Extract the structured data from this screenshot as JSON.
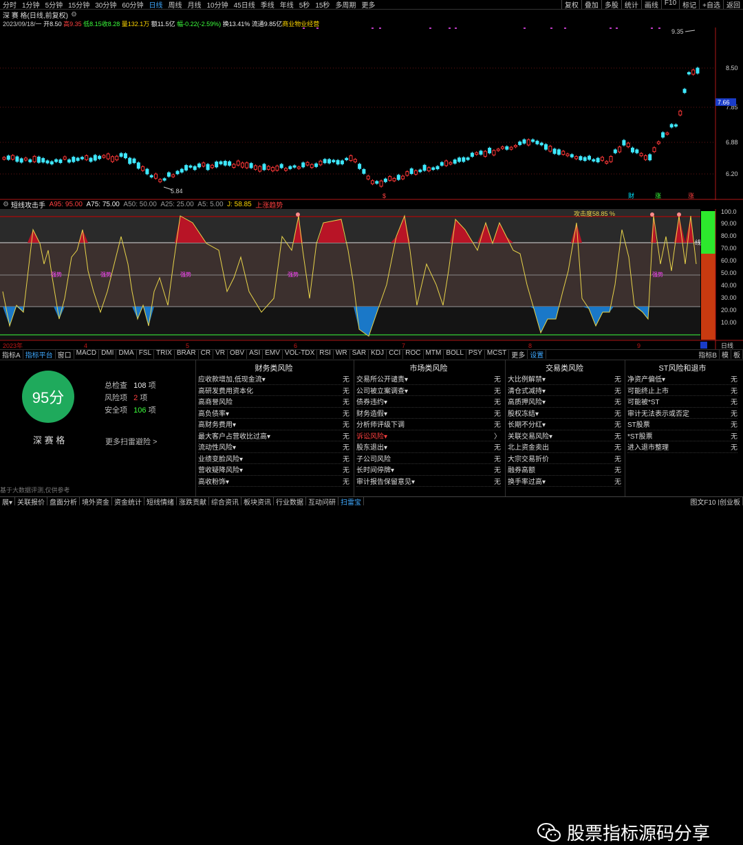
{
  "topbar": {
    "timeframes": [
      "分时",
      "1分钟",
      "5分钟",
      "15分钟",
      "30分钟",
      "60分钟",
      "日线",
      "周线",
      "月线",
      "10分钟",
      "45日线",
      "季线",
      "年线",
      "5秒",
      "15秒",
      "多周期",
      "更多"
    ],
    "active_tf": "日线",
    "right": [
      "复权",
      "叠加",
      "多股",
      "统计",
      "画线",
      "F10",
      "标记",
      "+自选",
      "返回"
    ]
  },
  "title": "深 赛 格(日线,前复权)",
  "info": {
    "date": "2023/09/18/一",
    "open": "开8.50",
    "high": "高9.35",
    "low": "低8.15",
    "close": "收8.28",
    "vol": "量132.1万",
    "amount": "额11.5亿",
    "change": "幅-0.22(-2.59%)",
    "turnover": "换13.41%",
    "float": "流通9.85亿",
    "sector": "商业物业经营"
  },
  "price_labels": {
    "p935": "9.35",
    "p850": "8.50",
    "p766": "7.66",
    "p785": "7.85",
    "p688": "6.88",
    "p620": "6.20",
    "p584": "5.84"
  },
  "markers": {
    "cai": "财",
    "zhang": "涨",
    "zhang2": "涨",
    "s": "$"
  },
  "indicator_bar": {
    "name": "短线攻击手",
    "a95": "A95: 95.00",
    "a75": "A75: 75.00",
    "a50": "A50: 50.00",
    "a25": "A25: 25.00",
    "a5": "A5: 5.00",
    "j": "J: 58.85",
    "trend": "上涨趋势"
  },
  "ind_labels": {
    "attack": "攻击度58.85 %",
    "weak": "强势",
    "side": "线"
  },
  "ind_axis": [
    "100.0",
    "90.00",
    "80.00",
    "70.00",
    "60.00",
    "50.00",
    "40.00",
    "30.00",
    "20.00",
    "10.00"
  ],
  "time_axis": {
    "y2023": "2023年",
    "m4": "4",
    "m5": "5",
    "m6": "6",
    "m7": "7",
    "m8": "8",
    "m9": "9",
    "daily": "日线"
  },
  "tabs": [
    "指标A",
    "指标平台",
    "窗口",
    "MACD",
    "DMI",
    "DMA",
    "FSL",
    "TRIX",
    "BRAR",
    "CR",
    "VR",
    "OBV",
    "ASI",
    "EMV",
    "VOL-TDX",
    "RSI",
    "WR",
    "SAR",
    "KDJ",
    "CCI",
    "ROC",
    "MTM",
    "BOLL",
    "PSY",
    "MCST",
    "更多",
    "设置"
  ],
  "tabs_right": [
    "指标B",
    "模",
    "板"
  ],
  "panel": {
    "score": "95分",
    "name": "深 赛 格",
    "total_label": "总检查",
    "total": "108",
    "total_unit": "项",
    "risk_label": "风险项",
    "risk": "2",
    "risk_unit": "项",
    "safe_label": "安全项",
    "safe": "106",
    "safe_unit": "项",
    "more": "更多扫雷避险 >",
    "disclaimer": "基于大数据评测,仅供参考"
  },
  "columns": [
    {
      "title": "财务类风险",
      "rows": [
        [
          "应收款增加,低现金流▾",
          "无"
        ],
        [
          "高研发费用资本化",
          "无"
        ],
        [
          "高商誉风险",
          "无"
        ],
        [
          "高负债率▾",
          "无"
        ],
        [
          "高财务费用▾",
          "无"
        ],
        [
          "最大客户占营收比过高▾",
          "无"
        ],
        [
          "流动性风险▾",
          "无"
        ],
        [
          "业绩变脸风险▾",
          "无"
        ],
        [
          "营收疑降风险▾",
          "无"
        ],
        [
          "高收粉饰▾",
          "无"
        ]
      ]
    },
    {
      "title": "市场类风险",
      "rows": [
        [
          "交易所公开谴责▾",
          "无"
        ],
        [
          "公司被立案调查▾",
          "无"
        ],
        [
          "债券违约▾",
          "无"
        ],
        [
          "财务造假▾",
          "无"
        ],
        [
          "分析师评级下调",
          "无"
        ],
        [
          "诉讼风险▾",
          "〉"
        ],
        [
          "股东退出▾",
          "无"
        ],
        [
          "子公司风险",
          "无"
        ],
        [
          "长时间停牌▾",
          "无"
        ],
        [
          "审计报告保留意见▾",
          "无"
        ]
      ]
    },
    {
      "title": "交易类风险",
      "rows": [
        [
          "大比例解禁▾",
          "无"
        ],
        [
          "清仓式减持▾",
          "无"
        ],
        [
          "高质押风险▾",
          "无"
        ],
        [
          "股权冻结▾",
          "无"
        ],
        [
          "长期不分红▾",
          "无"
        ],
        [
          "关联交易风险▾",
          "无"
        ],
        [
          "北上资金卖出",
          "无"
        ],
        [
          "大宗交易折价",
          "无"
        ],
        [
          "融券高额",
          "无"
        ],
        [
          "换手率过高▾",
          "无"
        ]
      ]
    },
    {
      "title": "ST风险和退市",
      "rows": [
        [
          "净资产偏低▾",
          "无"
        ],
        [
          "可能终止上市",
          "无"
        ],
        [
          "可能被*ST",
          "无"
        ],
        [
          "审计无法表示或否定",
          "无"
        ],
        [
          "ST股票",
          "无"
        ],
        [
          "*ST股票",
          "无"
        ],
        [
          "进入退市整理",
          "无"
        ]
      ]
    }
  ],
  "watermark": "股票指标源码分享",
  "bottombar": [
    "展▾",
    "关联报价",
    "盘面分析",
    "境外资金",
    "资金统计",
    "短线情绪",
    "涨跌贡献",
    "综合资讯",
    "板块资讯",
    "行业数据",
    "互动问研",
    "扫雷宝"
  ],
  "bottombar_active": "扫雷宝",
  "bottombar_right": "图文F10 |创业板"
}
